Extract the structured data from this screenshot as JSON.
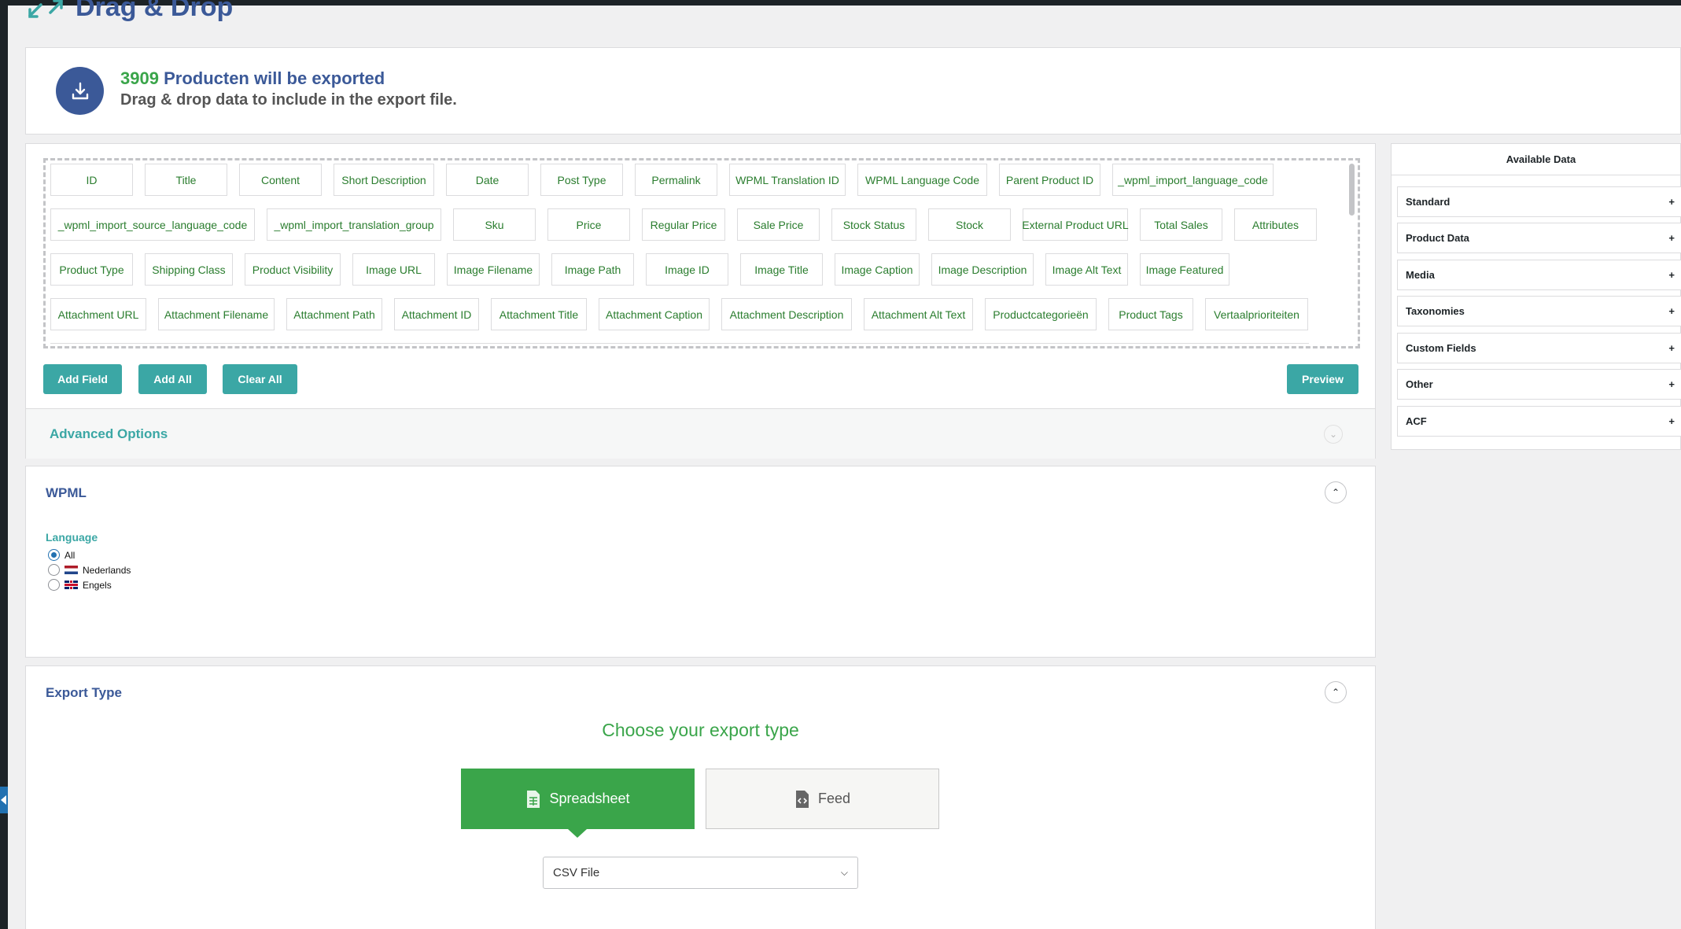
{
  "page": {
    "title": "Drag & Drop"
  },
  "header": {
    "count": "3909",
    "count_suffix": "Producten will be exported",
    "subtitle": "Drag & drop data to include in the export file."
  },
  "fields": [
    "ID",
    "Title",
    "Content",
    "Short Description",
    "Date",
    "Post Type",
    "Permalink",
    "WPML Translation ID",
    "WPML Language Code",
    "Parent Product ID",
    "_wpml_import_language_code",
    "_wpml_import_source_language_code",
    "_wpml_import_translation_group",
    "Sku",
    "Price",
    "Regular Price",
    "Sale Price",
    "Stock Status",
    "Stock",
    "External Product URL",
    "Total Sales",
    "Attributes",
    "Product Type",
    "Shipping Class",
    "Product Visibility",
    "Image URL",
    "Image Filename",
    "Image Path",
    "Image ID",
    "Image Title",
    "Image Caption",
    "Image Description",
    "Image Alt Text",
    "Image Featured",
    "Attachment URL",
    "Attachment Filename",
    "Attachment Path",
    "Attachment ID",
    "Attachment Title",
    "Attachment Caption",
    "Attachment Description",
    "Attachment Alt Text",
    "Productcategorieën",
    "Product Tags",
    "Vertaalprioriteiten"
  ],
  "actions": {
    "add_field": "Add Field",
    "add_all": "Add All",
    "clear_all": "Clear All",
    "preview": "Preview"
  },
  "advanced": {
    "title": "Advanced Options"
  },
  "wpml": {
    "title": "WPML",
    "language_label": "Language",
    "options": [
      "All",
      "Nederlands",
      "Engels"
    ],
    "selected": "All"
  },
  "export_type": {
    "title": "Export Type",
    "heading": "Choose your export type",
    "spreadsheet": "Spreadsheet",
    "feed": "Feed",
    "selected": "Spreadsheet",
    "file_format": "CSV File"
  },
  "sidebar": {
    "title": "Available Data",
    "items": [
      "Standard",
      "Product Data",
      "Media",
      "Taxonomies",
      "Custom Fields",
      "Other",
      "ACF"
    ]
  },
  "colors": {
    "brand": "#3b5998",
    "green": "#3aa54a",
    "teal": "#3ba7a5"
  }
}
